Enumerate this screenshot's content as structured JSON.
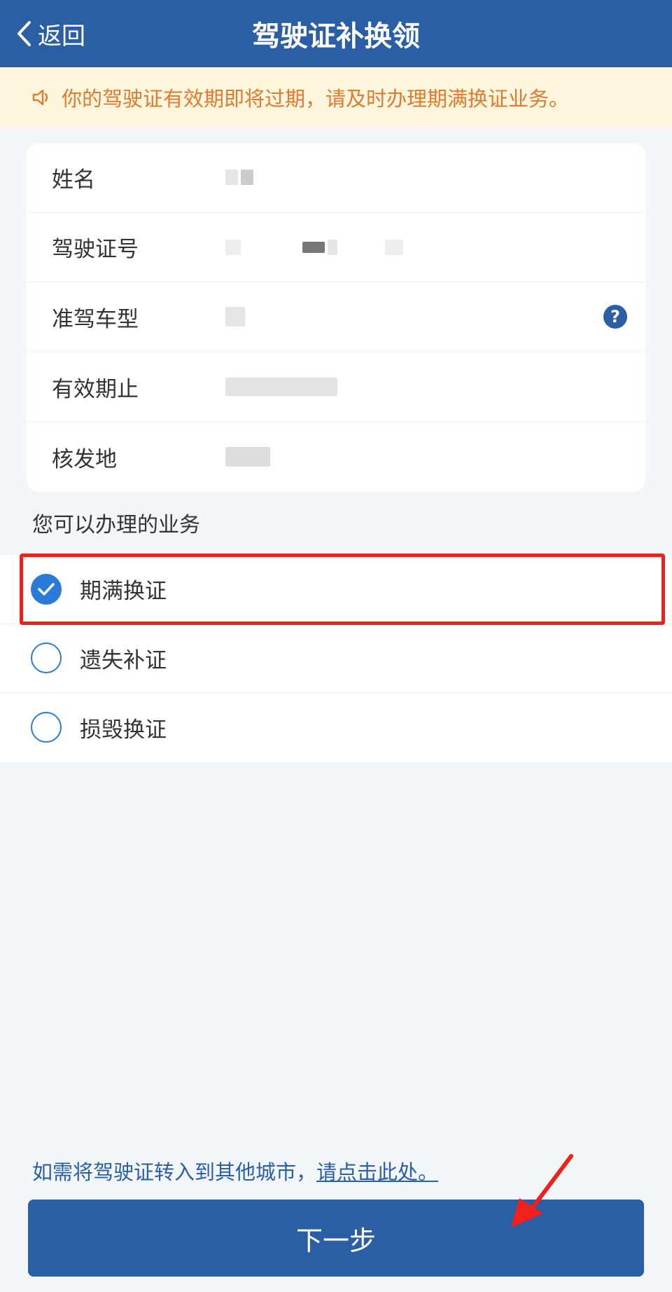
{
  "header": {
    "back_label": "返回",
    "title": "驾驶证补换领"
  },
  "notice": {
    "text": "你的驾驶证有效期即将过期，请及时办理期满换证业务。"
  },
  "info": {
    "rows": [
      {
        "label": "姓名"
      },
      {
        "label": "驾驶证号"
      },
      {
        "label": "准驾车型"
      },
      {
        "label": "有效期止"
      },
      {
        "label": "核发地"
      }
    ]
  },
  "services": {
    "title": "您可以办理的业务",
    "options": [
      {
        "label": "期满换证",
        "checked": true
      },
      {
        "label": "遗失补证",
        "checked": false
      },
      {
        "label": "损毁换证",
        "checked": false
      }
    ]
  },
  "transfer": {
    "text": "如需将驾驶证转入到其他城市，",
    "link": "请点击此处。"
  },
  "footer": {
    "next_label": "下一步"
  },
  "colors": {
    "primary": "#2a5fa6",
    "notice_text": "#e07a2e",
    "notice_bg": "#fdf5dc",
    "highlight": "#f0201a",
    "radio": "#2a7bd8"
  }
}
